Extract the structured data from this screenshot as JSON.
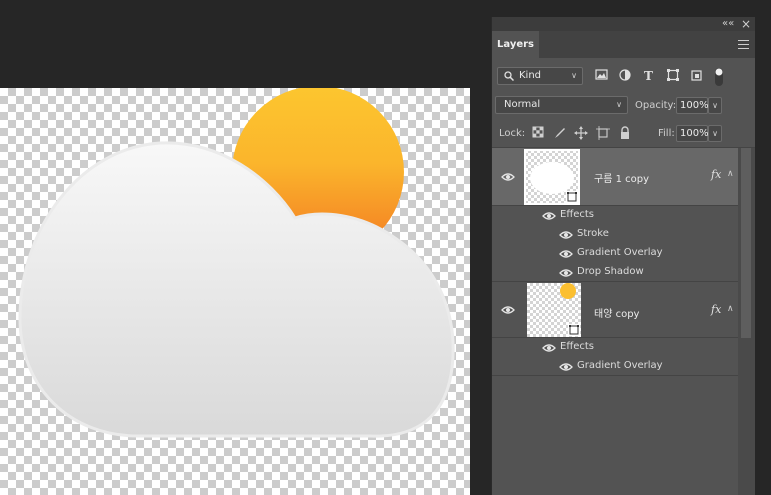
{
  "canvas": {
    "illustration": "cloud-and-sun",
    "sun_color_top": "#fcc62f",
    "sun_color_bottom": "#f47d22",
    "cloud_color_top": "#f7f7f7",
    "cloud_color_bottom": "#dcdcdc"
  },
  "panel": {
    "collapse_label": "««",
    "close_label": "×",
    "tab_label": "Layers",
    "menu_icon": "hamburger-menu-icon",
    "filter": {
      "kind_value": "Kind",
      "icons": [
        "image-filter-icon",
        "adjustment-filter-icon",
        "type-filter-icon",
        "shape-filter-icon",
        "smart-object-filter-icon"
      ]
    },
    "blend": {
      "mode": "Normal",
      "opacity_label": "Opacity:",
      "opacity_value": "100%"
    },
    "lock": {
      "label": "Lock:",
      "fill_label": "Fill:",
      "fill_value": "100%"
    },
    "layers": [
      {
        "name": "구름 1 copy",
        "selected": true,
        "fx_label": "fx",
        "effects_label": "Effects",
        "effects": [
          "Stroke",
          "Gradient Overlay",
          "Drop Shadow"
        ]
      },
      {
        "name": "태양 copy",
        "selected": false,
        "fx_label": "fx",
        "effects_label": "Effects",
        "effects": [
          "Gradient Overlay"
        ]
      }
    ]
  },
  "colors": {
    "workspace": "#262626",
    "panel": "#535353",
    "selected_layer": "#686868"
  }
}
